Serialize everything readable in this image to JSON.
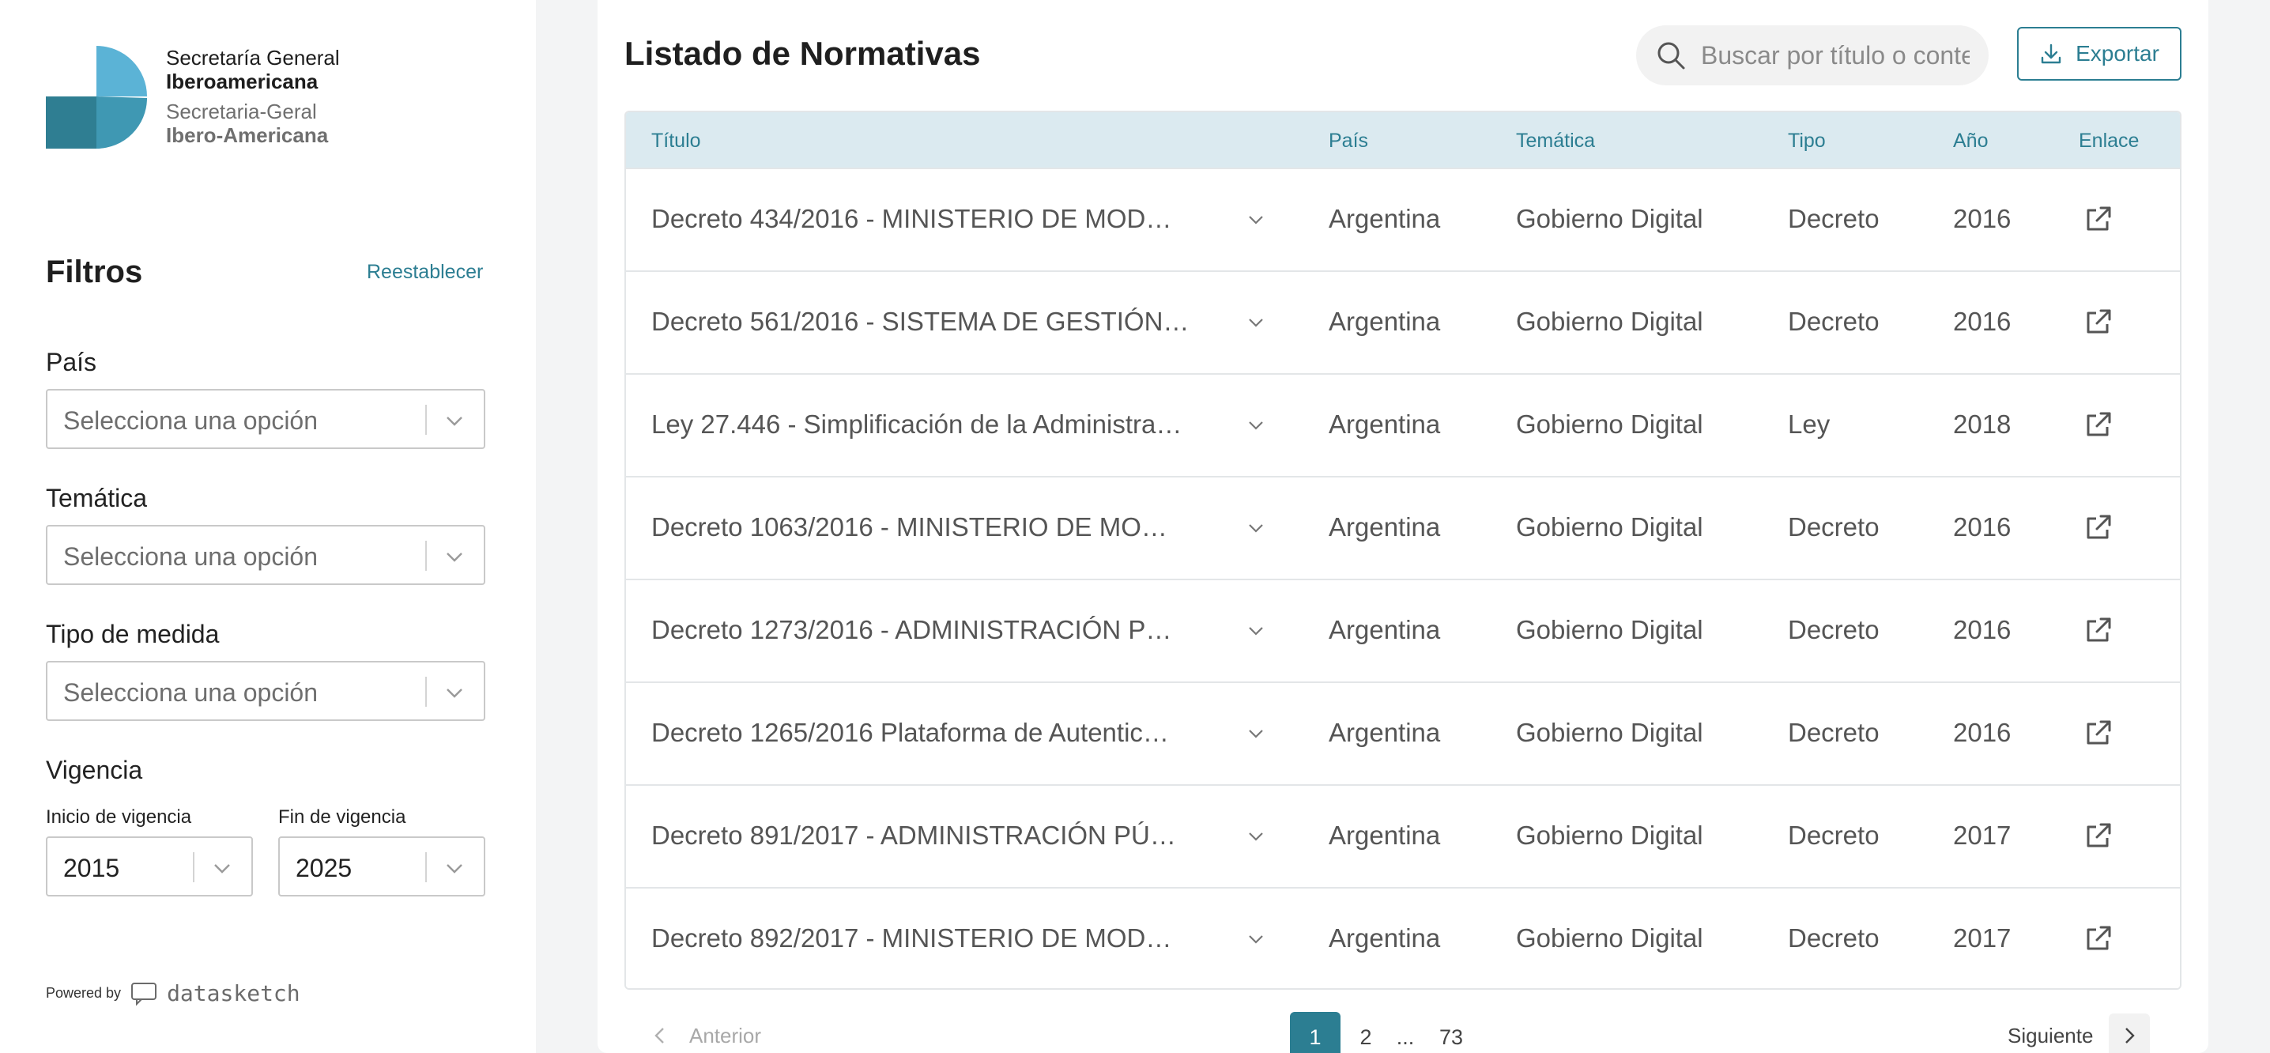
{
  "brand": {
    "line1": "Secretaría General",
    "line2": "Iberoamericana",
    "line3": "Secretaria-Geral",
    "line4": "Ibero-Americana",
    "color_light": "#5bb3d6",
    "color_dark": "#2f7e92"
  },
  "filters": {
    "title": "Filtros",
    "reset_label": "Reestablecer",
    "pais": {
      "label": "País",
      "value": "Selecciona una opción"
    },
    "tematica": {
      "label": "Temática",
      "value": "Selecciona una opción"
    },
    "tipo": {
      "label": "Tipo de medida",
      "value": "Selecciona una opción"
    },
    "vigencia": {
      "label": "Vigencia",
      "start_label": "Inicio de vigencia",
      "start_value": "2015",
      "end_label": "Fin de vigencia",
      "end_value": "2025"
    }
  },
  "footer": {
    "powered_by": "Powered by",
    "brand": "datasketch"
  },
  "main": {
    "title": "Listado de Normativas",
    "search_placeholder": "Buscar por título o contenido",
    "export_label": "Exportar",
    "accent": "#2c7e92",
    "header_bg": "#dbeaf0"
  },
  "table": {
    "headers": [
      "Título",
      "País",
      "Temática",
      "Tipo",
      "Año",
      "Enlace"
    ],
    "rows": [
      [
        "Decreto 434/2016 - MINISTERIO DE MOD…",
        "Argentina",
        "Gobierno Digital",
        "Decreto",
        "2016"
      ],
      [
        "Decreto 561/2016 - SISTEMA DE GESTIÓN…",
        "Argentina",
        "Gobierno Digital",
        "Decreto",
        "2016"
      ],
      [
        "Ley 27.446 - Simplificación de la Administra…",
        "Argentina",
        "Gobierno Digital",
        "Ley",
        "2018"
      ],
      [
        "Decreto 1063/2016 - MINISTERIO DE MO…",
        "Argentina",
        "Gobierno Digital",
        "Decreto",
        "2016"
      ],
      [
        "Decreto 1273/2016 - ADMINISTRACIÓN P…",
        "Argentina",
        "Gobierno Digital",
        "Decreto",
        "2016"
      ],
      [
        "Decreto 1265/2016 Plataforma de Autentic…",
        "Argentina",
        "Gobierno Digital",
        "Decreto",
        "2016"
      ],
      [
        "Decreto 891/2017 - ADMINISTRACIÓN PÚ…",
        "Argentina",
        "Gobierno Digital",
        "Decreto",
        "2017"
      ],
      [
        "Decreto 892/2017 - MINISTERIO DE MOD…",
        "Argentina",
        "Gobierno Digital",
        "Decreto",
        "2017"
      ]
    ],
    "row_icons": {
      "expand": "chevron-down-icon",
      "link": "external-link-icon"
    }
  },
  "pagination": {
    "prev_label": "Anterior",
    "next_label": "Siguiente",
    "pages": [
      "1",
      "2",
      "...",
      "73"
    ],
    "current": "1"
  }
}
